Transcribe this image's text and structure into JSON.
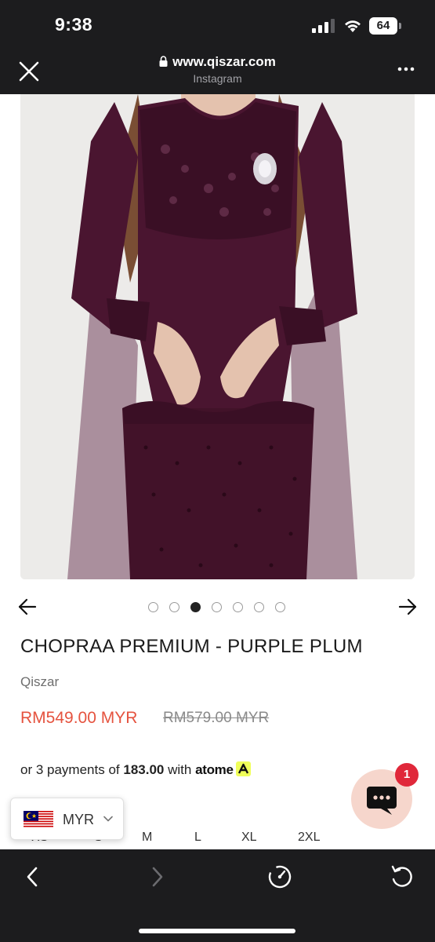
{
  "status_bar": {
    "time": "9:38",
    "battery_level": "64"
  },
  "browser": {
    "url": "www.qiszar.com",
    "source": "Instagram"
  },
  "product": {
    "title": "CHOPRAA PREMIUM - PURPLE PLUM",
    "brand": "Qiszar",
    "sale_price": "RM549.00 MYR",
    "original_price": "RM579.00 MYR",
    "installment_prefix": "or 3 payments of",
    "installment_amount": "183.00",
    "installment_with": "with",
    "installment_provider": "atome"
  },
  "carousel": {
    "total": 7,
    "active_index": 2
  },
  "sizes": [
    "XS",
    "S",
    "M",
    "L",
    "XL",
    "2XL"
  ],
  "currency": {
    "code": "MYR"
  },
  "chat": {
    "badge_count": "1"
  },
  "colors": {
    "sale_price": "#e5533f",
    "dress": "#4a1530",
    "chat_bubble_bg": "#f6d6cc",
    "badge": "#e0283a",
    "chrome": "#1c1c1e"
  },
  "icons": {
    "close": "close-icon",
    "lock": "lock-icon",
    "more": "more-dots-icon",
    "prev": "arrow-left-icon",
    "next": "arrow-right-icon",
    "chat": "chat-icon",
    "back": "chevron-left-icon",
    "forward": "chevron-right-icon",
    "speed": "speedometer-icon",
    "reload": "reload-icon"
  }
}
